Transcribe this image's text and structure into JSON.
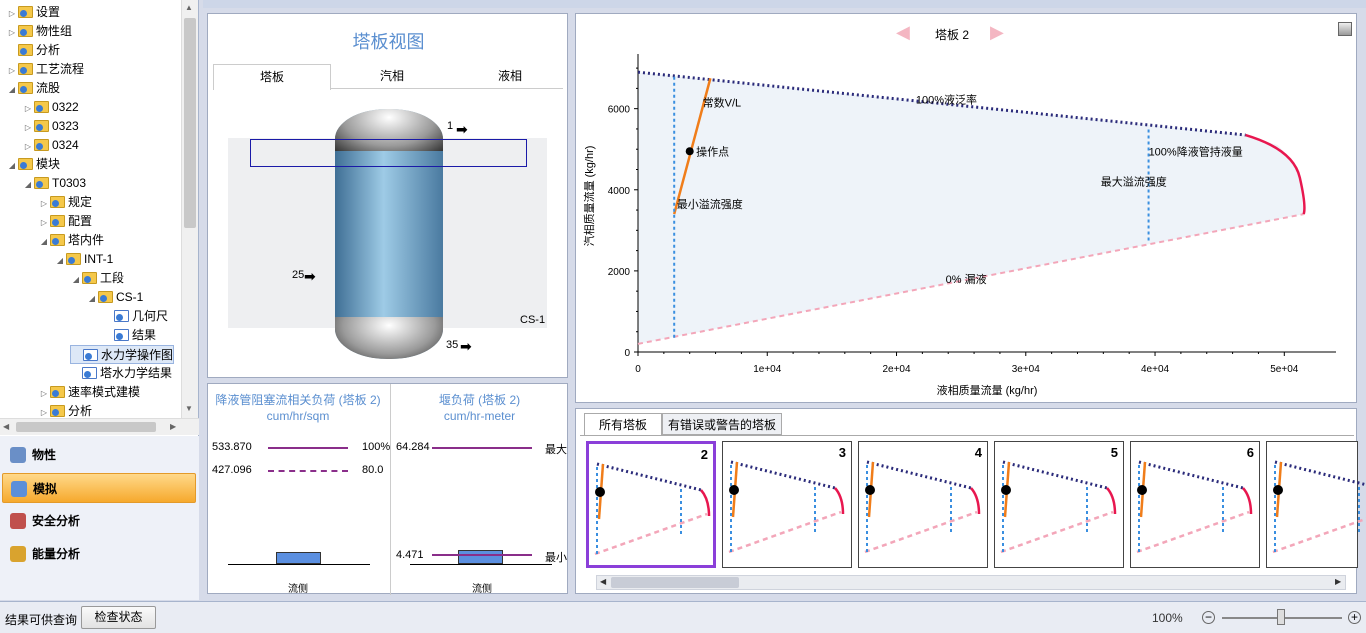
{
  "tree": {
    "items": [
      {
        "label": "设置",
        "level": 0,
        "exp": "▷",
        "icon": "folder"
      },
      {
        "label": "物性组",
        "level": 0,
        "exp": "▷",
        "icon": "folder"
      },
      {
        "label": "分析",
        "level": 0,
        "exp": "",
        "icon": "folder"
      },
      {
        "label": "工艺流程",
        "level": 0,
        "exp": "▷",
        "icon": "folder"
      },
      {
        "label": "流股",
        "level": 0,
        "exp": "◢",
        "icon": "folder"
      },
      {
        "label": "0322",
        "level": 1,
        "exp": "▷",
        "icon": "folder"
      },
      {
        "label": "0323",
        "level": 1,
        "exp": "▷",
        "icon": "folder"
      },
      {
        "label": "0324",
        "level": 1,
        "exp": "▷",
        "icon": "folder"
      },
      {
        "label": "模块",
        "level": 0,
        "exp": "◢",
        "icon": "folder"
      },
      {
        "label": "T0303",
        "level": 1,
        "exp": "◢",
        "icon": "folder"
      },
      {
        "label": "规定",
        "level": 2,
        "exp": "▷",
        "icon": "folder"
      },
      {
        "label": "配置",
        "level": 2,
        "exp": "▷",
        "icon": "folder"
      },
      {
        "label": "塔内件",
        "level": 2,
        "exp": "◢",
        "icon": "folder"
      },
      {
        "label": "INT-1",
        "level": 3,
        "exp": "◢",
        "icon": "folder"
      },
      {
        "label": "工段",
        "level": 4,
        "exp": "◢",
        "icon": "folder"
      },
      {
        "label": "CS-1",
        "level": 5,
        "exp": "◢",
        "icon": "folder"
      },
      {
        "label": "几何尺",
        "level": 6,
        "exp": "",
        "icon": "doc"
      },
      {
        "label": "结果",
        "level": 6,
        "exp": "",
        "icon": "doc"
      },
      {
        "label": "水力学操作图",
        "level": 4,
        "exp": "",
        "icon": "doc",
        "selected": true
      },
      {
        "label": "塔水力学结果",
        "level": 4,
        "exp": "",
        "icon": "doc"
      },
      {
        "label": "速率模式建模",
        "level": 2,
        "exp": "▷",
        "icon": "folder"
      },
      {
        "label": "分析",
        "level": 2,
        "exp": "▷",
        "icon": "folder"
      }
    ]
  },
  "nav": [
    {
      "label": "物性",
      "icon": "flask-icon",
      "color": "#6a8fc7"
    },
    {
      "label": "模拟",
      "icon": "flowsheet-icon",
      "color": "#5b8fd9",
      "active": true
    },
    {
      "label": "安全分析",
      "icon": "safety-icon",
      "color": "#c0504d"
    },
    {
      "label": "能量分析",
      "icon": "energy-icon",
      "color": "#d9a32e"
    }
  ],
  "status": {
    "text": "结果可供查询",
    "check_button": "检查状态",
    "zoom": "100%"
  },
  "tray_view": {
    "title": "塔板视图",
    "tabs": [
      "塔板",
      "汽相",
      "液相"
    ],
    "streams": {
      "top": "1",
      "feed": "25",
      "bottom": "35"
    },
    "section": "CS-1"
  },
  "loads": {
    "left": {
      "title": "降液管阻塞流相关负荷 (塔板 2)",
      "unit": "cum/hr/sqm",
      "v1": "533.870",
      "v2": "427.096",
      "p1": "100%",
      "p2": "80.0",
      "base": "流侧"
    },
    "right": {
      "title": "堰负荷 (塔板 2)",
      "unit": "cum/hr-meter",
      "v1": "64.284",
      "v2": "4.471",
      "l1": "最大",
      "l2": "最小",
      "base": "流侧"
    }
  },
  "plot": {
    "nav_label": "塔板 2",
    "xlabel": "液相质量流量 (kg/hr)",
    "ylabel": "汽相质量流量 (kg/hr)",
    "xticks": [
      "0",
      "1e+04",
      "2e+04",
      "3e+04",
      "4e+04",
      "5e+04"
    ],
    "yticks": [
      "0",
      "2000",
      "4000",
      "6000"
    ],
    "labels": {
      "flood": "100%液泛率",
      "const_vl": "常数V/L",
      "op_point": "操作点",
      "min_weir": "最小溢流强度",
      "max_weir": "最大溢流强度",
      "dc_backup": "100%降液管持液量",
      "weep": "0% 漏液"
    }
  },
  "chart_data": {
    "type": "line",
    "title": "塔板 2",
    "xlabel": "液相质量流量 (kg/hr)",
    "ylabel": "汽相质量流量 (kg/hr)",
    "xlim": [
      0,
      54000
    ],
    "ylim": [
      0,
      7200
    ],
    "series": [
      {
        "name": "100%液泛率",
        "x": [
          0,
          47000
        ],
        "y": [
          6900,
          5350
        ]
      },
      {
        "name": "0% 漏液",
        "x": [
          0,
          51500
        ],
        "y": [
          200,
          3400
        ]
      },
      {
        "name": "100%降液管持液量",
        "x": [
          47000,
          49500,
          50900,
          51300,
          51500
        ],
        "y": [
          5350,
          5100,
          4600,
          4000,
          3400
        ]
      },
      {
        "name": "常数V/L",
        "x": [
          2800,
          5600
        ],
        "y": [
          3400,
          6750
        ]
      },
      {
        "name": "最小溢流强度",
        "x": [
          2800,
          2800
        ],
        "y": [
          350,
          6850
        ]
      },
      {
        "name": "最大溢流强度",
        "x": [
          39500,
          39500
        ],
        "y": [
          2750,
          5550
        ]
      },
      {
        "name": "操作点",
        "x": [
          4000
        ],
        "y": [
          4950
        ]
      }
    ]
  },
  "bottom": {
    "tabs": [
      "所有塔板",
      "有错误或警告的塔板"
    ],
    "thumbs": [
      "2",
      "3",
      "4",
      "5",
      "6",
      ""
    ]
  }
}
